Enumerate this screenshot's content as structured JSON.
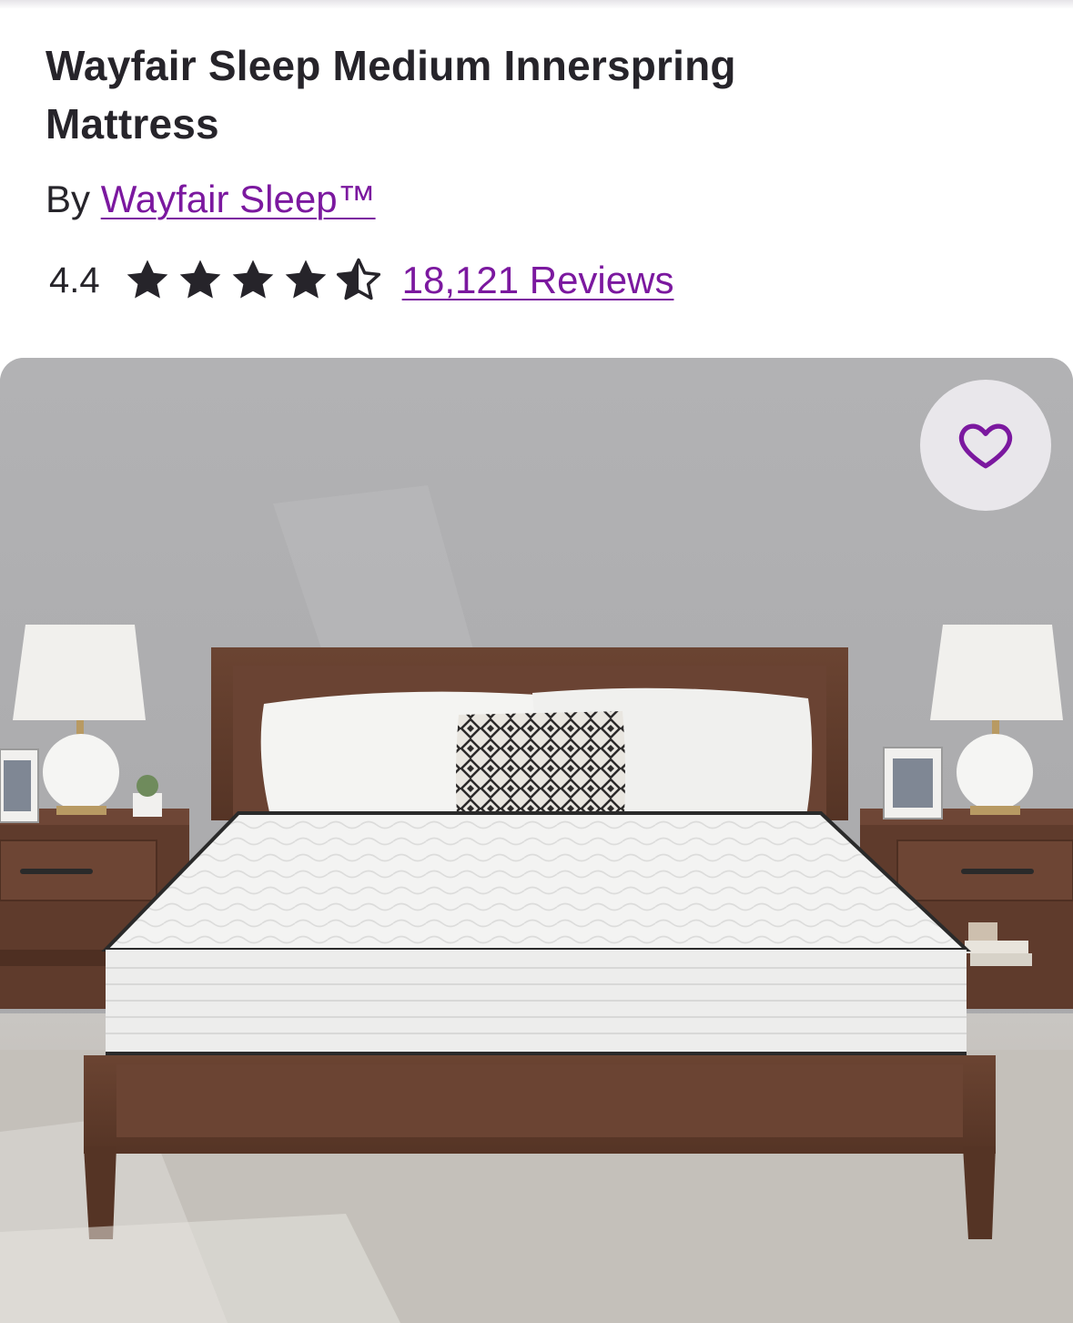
{
  "product": {
    "title": "Wayfair Sleep Medium Innerspring Mattress",
    "by_label": "By",
    "brand": "Wayfair Sleep™"
  },
  "rating": {
    "value": "4.4",
    "stars_out_of": 5,
    "stars_filled": 4.5,
    "reviews_label": "18,121 Reviews"
  },
  "image": {
    "favorite_icon": "heart-outline-icon"
  },
  "colors": {
    "brand_purple": "#7b189f",
    "text_dark": "#26242a"
  }
}
